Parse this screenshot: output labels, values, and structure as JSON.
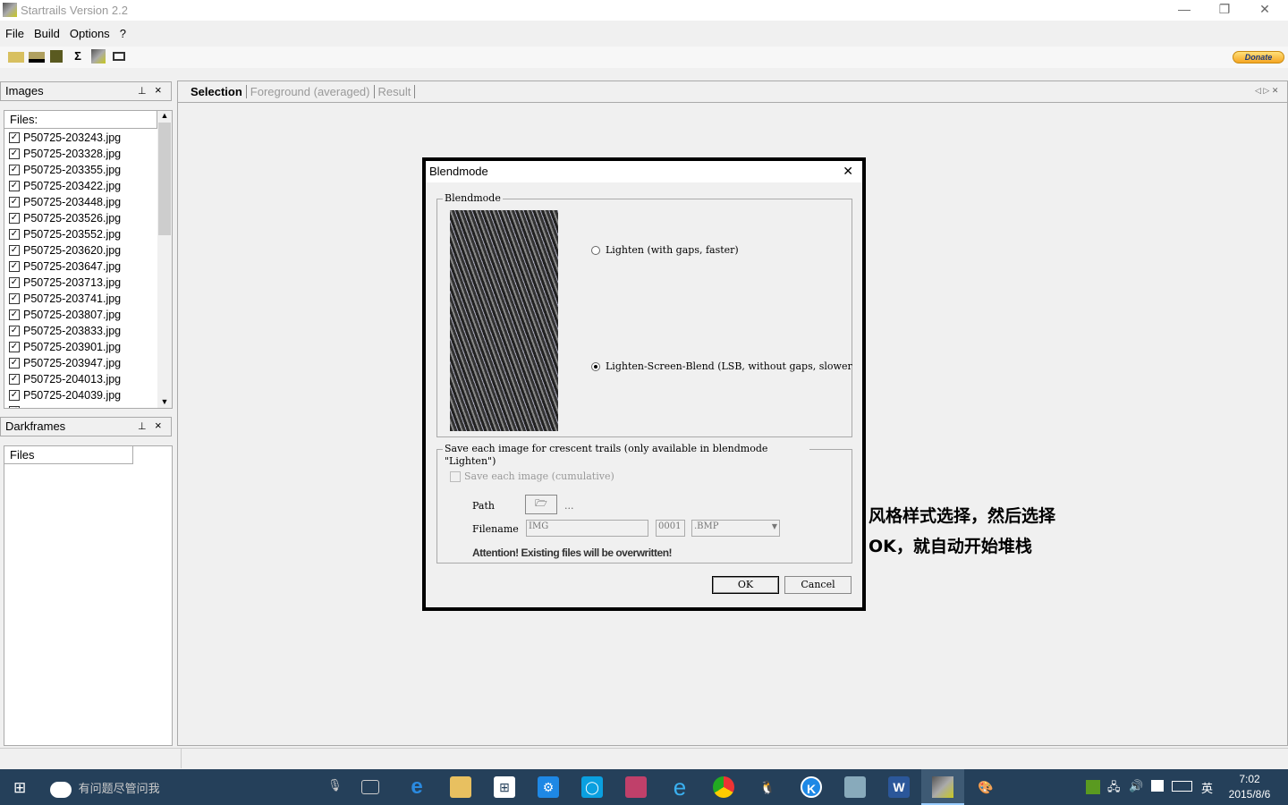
{
  "app": {
    "title": "Startrails Version 2.2",
    "minimize": "—",
    "restore": "❐",
    "close": "✕"
  },
  "menu": [
    "File",
    "Build",
    "Options",
    "?"
  ],
  "toolbar": {
    "icons": [
      "open-folder-icon",
      "open-multiple-icon",
      "save-icon",
      "sum-icon",
      "startrails-icon",
      "video-icon"
    ],
    "sum_glyph": "Σ",
    "donate": "Donate"
  },
  "images_panel": {
    "title": "Images",
    "pin": "📌",
    "close": "×",
    "column": "Files:",
    "files": [
      "P50725-203243.jpg",
      "P50725-203328.jpg",
      "P50725-203355.jpg",
      "P50725-203422.jpg",
      "P50725-203448.jpg",
      "P50725-203526.jpg",
      "P50725-203552.jpg",
      "P50725-203620.jpg",
      "P50725-203647.jpg",
      "P50725-203713.jpg",
      "P50725-203741.jpg",
      "P50725-203807.jpg",
      "P50725-203833.jpg",
      "P50725-203901.jpg",
      "P50725-203947.jpg",
      "P50725-204013.jpg",
      "P50725-204039.jpg"
    ]
  },
  "darkframes_panel": {
    "title": "Darkframes",
    "pin": "📌",
    "close": "×",
    "column": "Files"
  },
  "tabs": [
    "Selection",
    "Foreground (averaged)",
    "Result"
  ],
  "dialog": {
    "title": "Blendmode",
    "close": "✕",
    "group_label": "Blendmode",
    "options": [
      {
        "label": "Lighten (with gaps, faster)",
        "selected": false
      },
      {
        "label": "Lighten-Screen-Blend (LSB, without gaps, slower)",
        "selected": true
      }
    ],
    "crescent_label": "Save each image for crescent trails (only available in blendmode \"Lighten\")",
    "save_each": "Save each image (cumulative)",
    "path_label": "Path",
    "path_value": "...",
    "filename_label": "Filename",
    "filename_value": "IMG",
    "number_value": "0001",
    "format_value": ".BMP",
    "attention": "Attention! Existing files will be overwritten!",
    "ok": "OK",
    "cancel": "Cancel"
  },
  "annotation": {
    "line1": "风格样式选择，然后选择",
    "line2": "OK，就自动开始堆栈"
  },
  "taskbar": {
    "search": "有问题尽管问我",
    "time": "7:02",
    "date": "2015/8/6",
    "ime": "英"
  }
}
